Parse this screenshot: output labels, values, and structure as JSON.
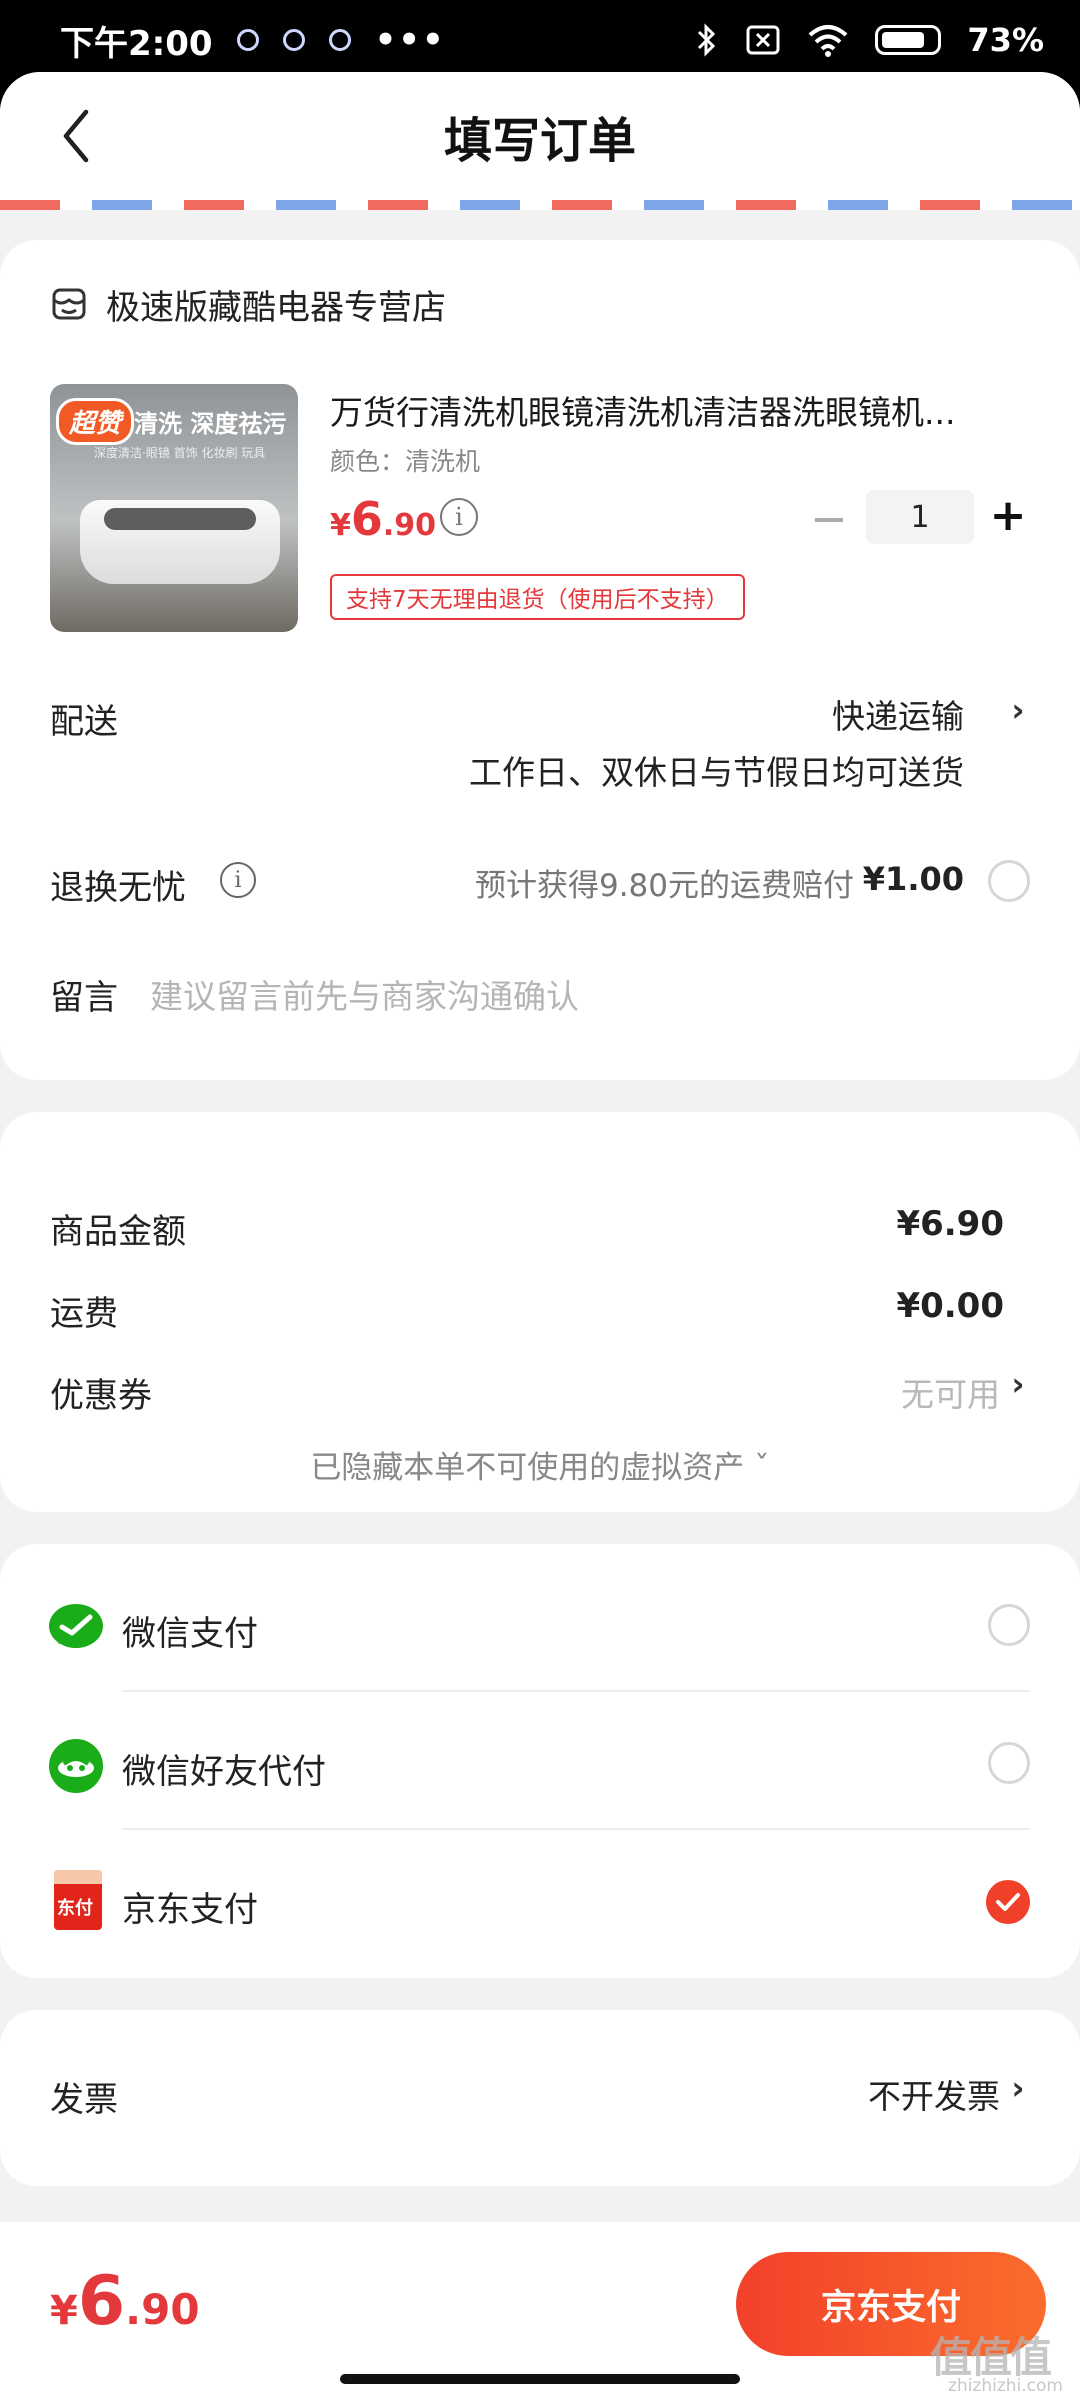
{
  "status_bar": {
    "time": "下午2:00",
    "more": "•••",
    "battery": "73%"
  },
  "header": {
    "title": "填写订单"
  },
  "order": {
    "store_name": "极速版藏酷电器专营店",
    "product": {
      "thumb_badge": "超赞",
      "thumb_headline": "清洗 深度祛污",
      "thumb_subline": "深度清洁·眼镜 首饰 化妆刷 玩具",
      "title": "万货行清洗机眼镜清洗机清洁器洗眼镜机...",
      "variant": "颜色：清洗机",
      "price_symbol": "¥",
      "price_integer": "6",
      "price_decimal": ".90",
      "quantity": "1",
      "return_policy": "支持7天无理由退货（使用后不支持）"
    },
    "delivery": {
      "label": "配送",
      "method": "快递运输",
      "note": "工作日、双休日与节假日均可送货"
    },
    "return_insurance": {
      "label": "退换无忧",
      "note": "预计获得9.80元的运费赔付",
      "price": "¥1.00",
      "selected": false
    },
    "memo": {
      "label": "留言",
      "placeholder": "建议留言前先与商家沟通确认"
    }
  },
  "amounts": {
    "goods_label": "商品金额",
    "goods_value": "¥6.90",
    "shipping_label": "运费",
    "shipping_value": "¥0.00",
    "coupon_label": "优惠券",
    "coupon_value": "无可用",
    "hidden_assets": "已隐藏本单不可使用的虚拟资产 ˇ"
  },
  "payment": {
    "methods": [
      {
        "label": "微信支付",
        "icon": "wechat-pay-icon",
        "selected": false
      },
      {
        "label": "微信好友代付",
        "icon": "wechat-friend-pay-icon",
        "selected": false
      },
      {
        "label": "京东支付",
        "icon": "jd-pay-icon",
        "icon_text": "东付",
        "selected": true
      }
    ]
  },
  "invoice": {
    "label": "发票",
    "value": "不开发票"
  },
  "footer": {
    "total_symbol": "¥",
    "total_integer": "6",
    "total_decimal": ".90",
    "pay_button": "京东支付"
  },
  "watermark": {
    "main": "值值值",
    "sub": "zhizhizhi.com"
  },
  "colors": {
    "accent": "#e4393c",
    "pay_button_start": "#f3402b",
    "pay_button_end": "#fa6d2b",
    "wechat_green": "#1aad19",
    "jd_red": "#e1251b",
    "background": "#f2f2f2"
  }
}
